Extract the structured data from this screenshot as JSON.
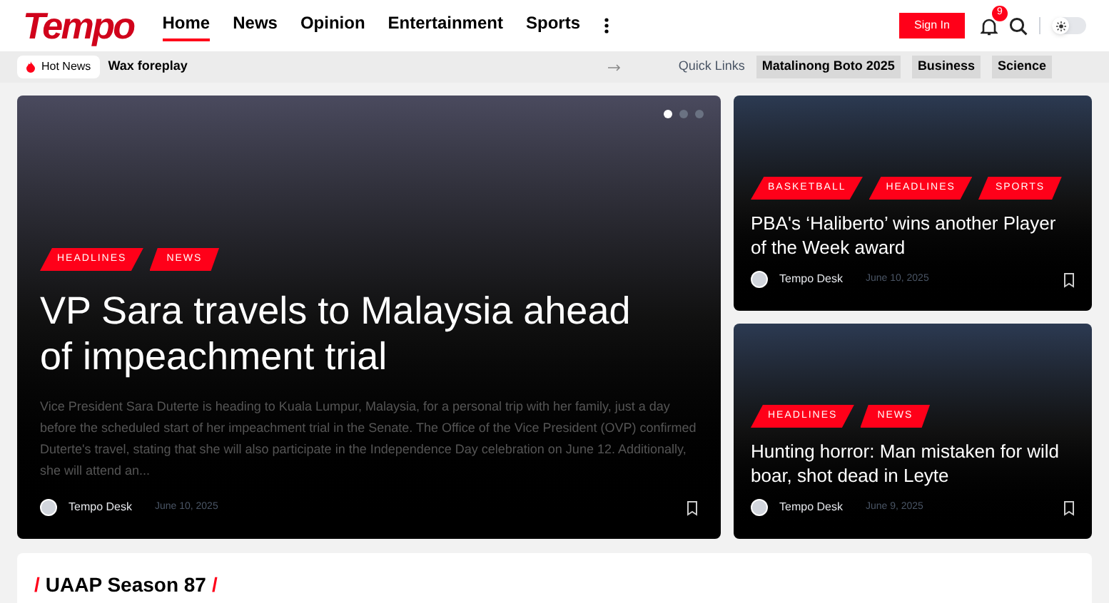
{
  "header": {
    "logo": "Tempo",
    "nav": [
      {
        "label": "Home",
        "selected": true
      },
      {
        "label": "News",
        "selected": false
      },
      {
        "label": "Opinion",
        "selected": false
      },
      {
        "label": "Entertainment",
        "selected": false
      },
      {
        "label": "Sports",
        "selected": false
      }
    ],
    "sign_in": "Sign In",
    "notification_count": "9",
    "dark_mode": false
  },
  "ticker": {
    "badge": "Hot News",
    "headline": "Wax foreplay",
    "quick_links_label": "Quick Links",
    "quick_links": [
      "Matalinong Boto 2025",
      "Business",
      "Science"
    ]
  },
  "featured": {
    "tags": [
      "HEADLINES",
      "NEWS"
    ],
    "title": "VP Sara travels to Malaysia ahead of impeachment trial",
    "excerpt": "Vice President Sara Duterte is heading to Kuala Lumpur, Malaysia, for a personal trip with her family, just a day before the scheduled start of her impeachment trial in the Senate. The Office of the Vice President (OVP) confirmed Duterte's travel, stating that she will also participate in the Independence Day celebration on June 12. Additionally, she will attend an...",
    "author": "Tempo Desk",
    "date": "June 10, 2025",
    "slides": [
      {
        "selected": true
      },
      {
        "selected": false
      },
      {
        "selected": false
      }
    ]
  },
  "side_articles": [
    {
      "tags": [
        "BASKETBALL",
        "HEADLINES",
        "SPORTS"
      ],
      "title": "PBA's ‘Haliberto’ wins another Player of the Week award",
      "author": "Tempo Desk",
      "date": "June 10, 2025"
    },
    {
      "tags": [
        "HEADLINES",
        "NEWS"
      ],
      "title": "Hunting horror: Man mistaken for wild boar, shot dead in Leyte",
      "author": "Tempo Desk",
      "date": "June 9, 2025"
    }
  ],
  "section": {
    "prefix": "/",
    "title": "UAAP Season 87",
    "suffix": "/"
  }
}
